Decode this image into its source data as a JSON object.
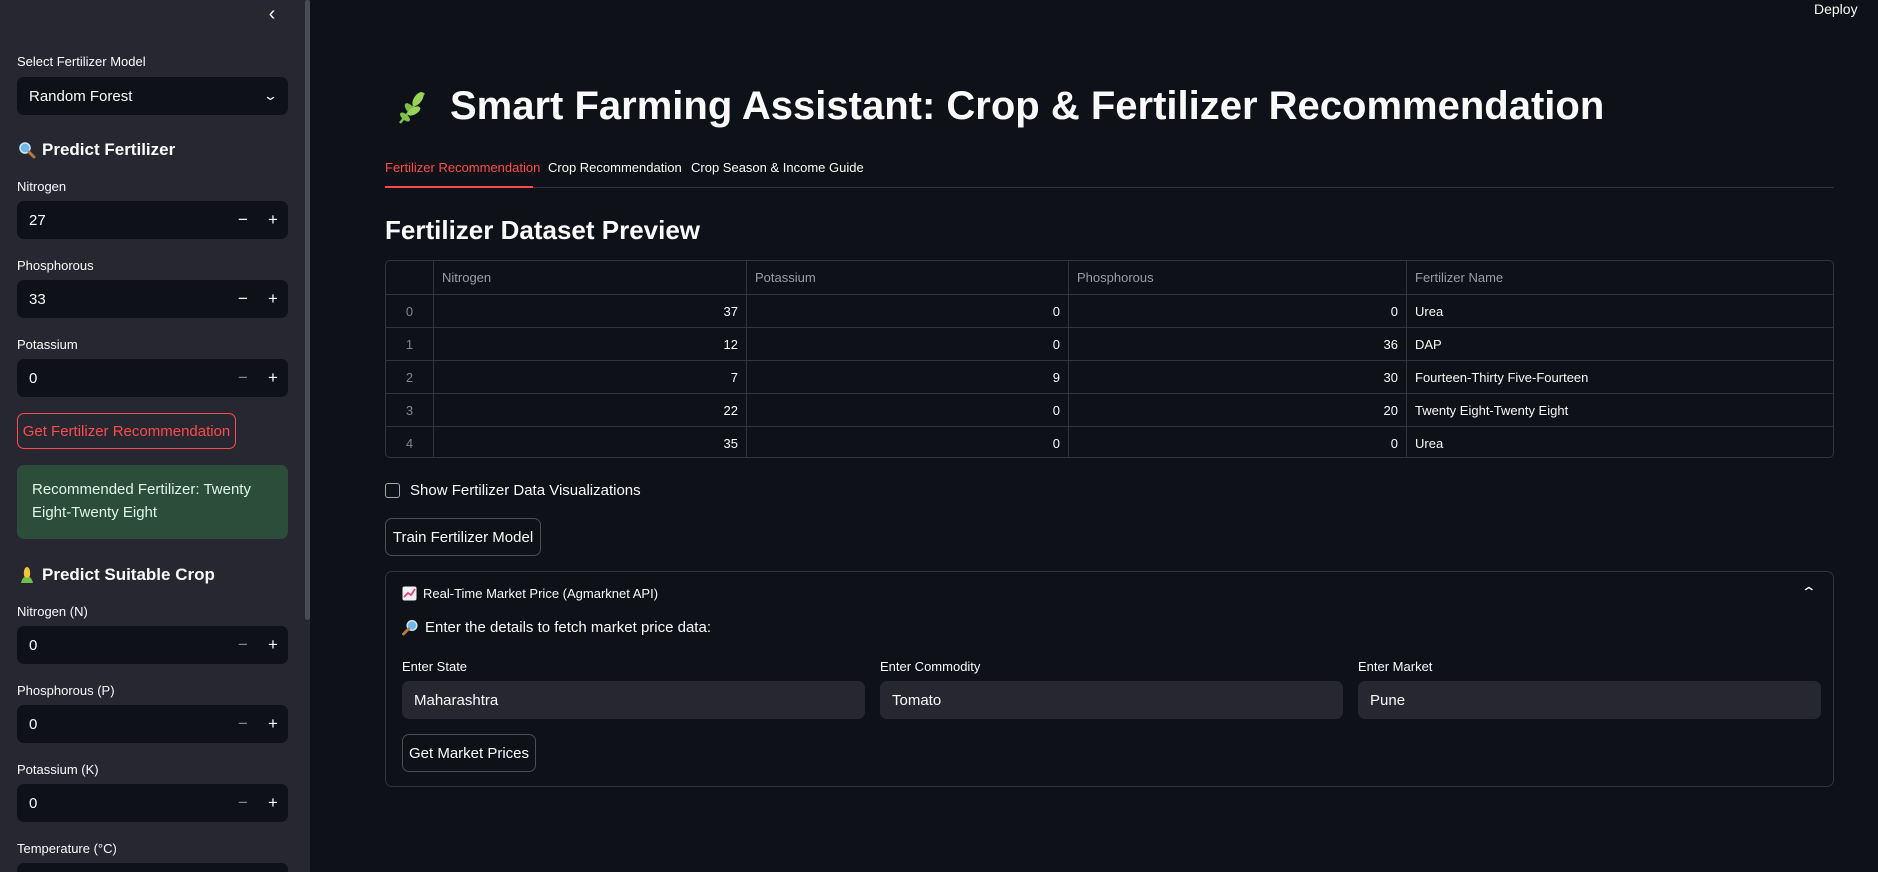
{
  "sidebar": {
    "model_label": "Select Fertilizer Model",
    "model_value": "Random Forest",
    "predict_fertilizer_heading": "Predict Fertilizer",
    "fert_inputs": [
      {
        "label": "Nitrogen",
        "value": "27"
      },
      {
        "label": "Phosphorous",
        "value": "33"
      },
      {
        "label": "Potassium",
        "value": "0"
      }
    ],
    "get_fert_button": "Get Fertilizer Recommendation",
    "result_text": "Recommended Fertilizer: Twenty Eight-Twenty Eight",
    "predict_crop_heading": "Predict Suitable Crop",
    "crop_inputs": [
      {
        "label": "Nitrogen (N)",
        "value": "0"
      },
      {
        "label": "Phosphorous (P)",
        "value": "0"
      },
      {
        "label": "Potassium (K)",
        "value": "0"
      }
    ],
    "temperature_label": "Temperature (°C)"
  },
  "header": {
    "deploy": "Deploy",
    "title": "Smart Farming Assistant: Crop & Fertilizer Recommendation"
  },
  "tabs": [
    "Fertilizer Recommendation",
    "Crop Recommendation",
    "Crop Season & Income Guide"
  ],
  "dataset": {
    "heading": "Fertilizer Dataset Preview",
    "columns": [
      "",
      "Nitrogen",
      "Potassium",
      "Phosphorous",
      "Fertilizer Name"
    ],
    "rows": [
      [
        "0",
        "37",
        "0",
        "0",
        "Urea"
      ],
      [
        "1",
        "12",
        "0",
        "36",
        "DAP"
      ],
      [
        "2",
        "7",
        "9",
        "30",
        "Fourteen-Thirty Five-Fourteen"
      ],
      [
        "3",
        "22",
        "0",
        "20",
        "Twenty Eight-Twenty Eight"
      ],
      [
        "4",
        "35",
        "0",
        "0",
        "Urea"
      ]
    ]
  },
  "show_viz_label": "Show Fertilizer Data Visualizations",
  "train_button": "Train Fertilizer Model",
  "market": {
    "title": "Real-Time Market Price (Agmarknet API)",
    "prompt": "Enter the details to fetch market price data:",
    "fields": [
      {
        "label": "Enter State",
        "value": "Maharashtra"
      },
      {
        "label": "Enter Commodity",
        "value": "Tomato"
      },
      {
        "label": "Enter Market",
        "value": "Pune"
      }
    ],
    "button": "Get Market Prices"
  },
  "colors": {
    "accent": "#ff4b4b",
    "success_bg": "#2b4d3a",
    "sidebar_bg": "#262730",
    "app_bg": "#0e1117"
  },
  "icons": {
    "title": "herb-icon",
    "fertilizer": "magnifier-icon",
    "crop": "corn-icon",
    "market": "chart-increasing-icon",
    "prompt": "magnifier-right-icon"
  }
}
